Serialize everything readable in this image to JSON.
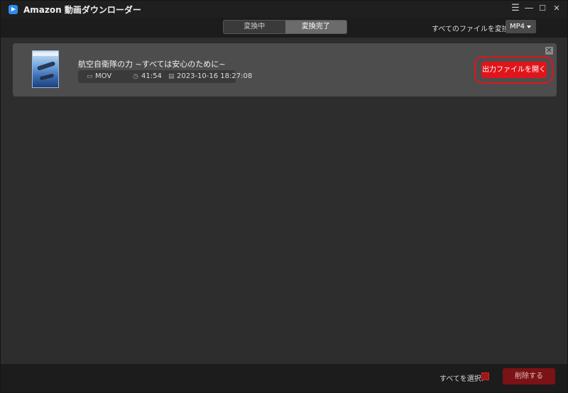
{
  "window": {
    "title": "Amazon 動画ダウンローダー",
    "controls": {
      "menu": "☰",
      "minimize": "—",
      "maximize": "☐",
      "close": "✕"
    }
  },
  "toolbar": {
    "tabs": [
      {
        "label": "変換中",
        "active": false
      },
      {
        "label": "変換完了",
        "active": true
      }
    ],
    "convert_all_label": "すべてのファイルを変換:",
    "format": "MP4"
  },
  "items": [
    {
      "title": "航空自衛隊の力 ~すべては安心のために~",
      "format": "MOV",
      "duration": "41:54",
      "datetime": "2023-10-16 18:27:08",
      "open_button": "出力ファイルを開く",
      "close": "✕"
    }
  ],
  "footer": {
    "select_all_label": "すべてを選択:",
    "delete_button": "削除する"
  },
  "colors": {
    "accent": "#e0151b",
    "background": "#2d2d2d",
    "card": "#4d4d4d",
    "bar": "#1c1c1c"
  },
  "icons": [
    "app-play-icon",
    "menu-icon",
    "minimize-icon",
    "maximize-icon",
    "close-icon",
    "video-icon",
    "clock-icon",
    "calendar-icon",
    "chevron-down-icon"
  ]
}
